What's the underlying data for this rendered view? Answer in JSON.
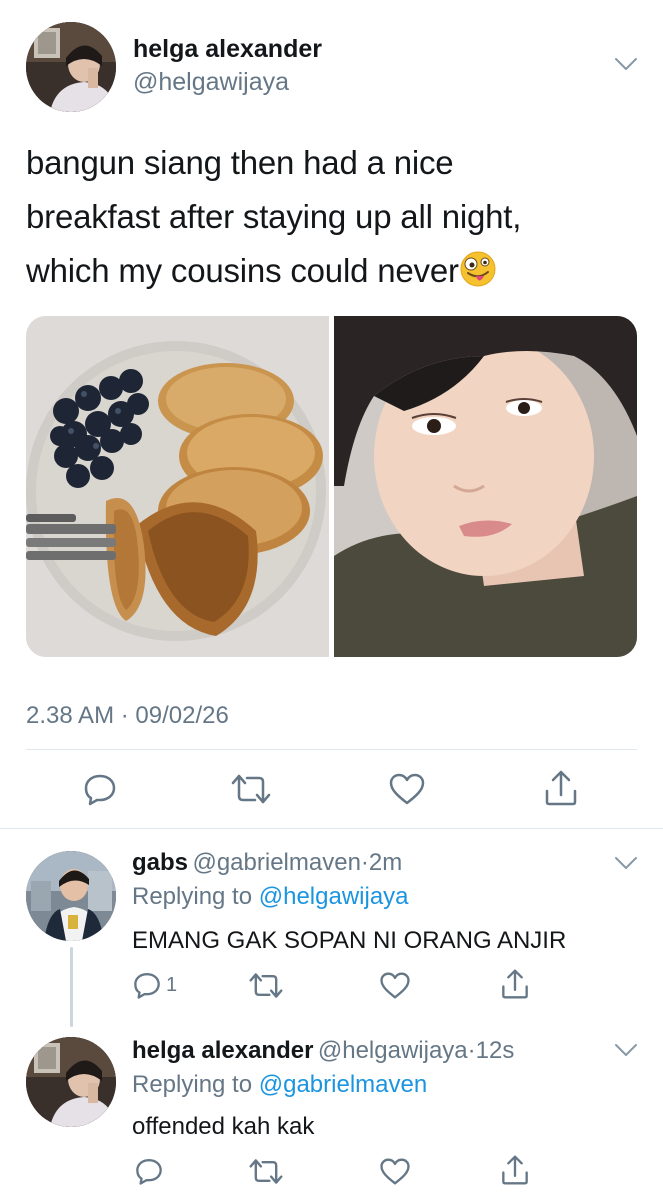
{
  "main_tweet": {
    "author_name": "helga alexander",
    "author_handle": "@helgawijaya",
    "text_line1": "bangun siang then had a nice",
    "text_line2": "breakfast after staying up all night,",
    "text_line3": "which my cousins could never",
    "emoji": "zany-face-emoji",
    "timestamp": "2.38 AM · 09/02/26",
    "media": [
      "pancakes-with-blueberries-photo",
      "selfie-photo"
    ],
    "actions": {
      "reply_icon": "reply-icon",
      "retweet_icon": "retweet-icon",
      "like_icon": "heart-icon",
      "share_icon": "share-icon"
    }
  },
  "replies": [
    {
      "author_name": "gabs",
      "author_handle": "@gabrielmaven",
      "separator": "·",
      "time": "2m",
      "replying_label": "Replying to",
      "replying_to": "@helgawijaya",
      "text": "EMANG GAK SOPAN NI ORANG ANJIR",
      "reply_count": "1"
    },
    {
      "author_name": "helga alexander",
      "author_handle": "@helgawijaya",
      "separator": "·",
      "time": "12s",
      "replying_label": "Replying to",
      "replying_to": "@gabrielmaven",
      "text": "offended kah kak",
      "reply_count": ""
    }
  ],
  "colors": {
    "text": "#14171a",
    "secondary": "#657786",
    "link": "#1b95e0",
    "divider": "#e1e8ed"
  }
}
